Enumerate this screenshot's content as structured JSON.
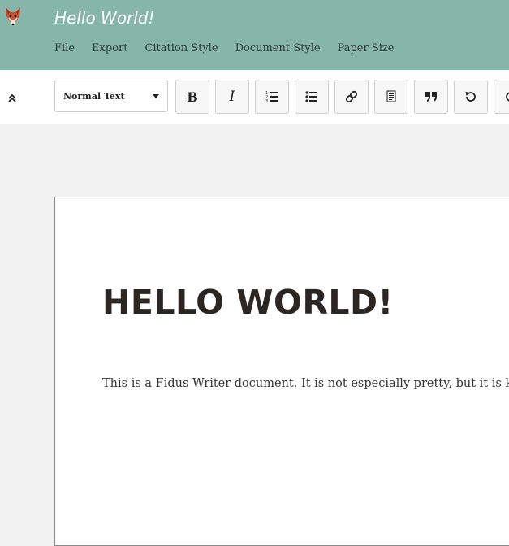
{
  "header": {
    "title": "Hello World!",
    "logo_icon": "fox-icon",
    "menu": [
      {
        "label": "File"
      },
      {
        "label": "Export"
      },
      {
        "label": "Citation Style"
      },
      {
        "label": "Document Style"
      },
      {
        "label": "Paper Size"
      }
    ]
  },
  "toolbar": {
    "collapse_icon": "double-chevron-up-icon",
    "block_type": {
      "selected": "Normal Text"
    },
    "buttons": [
      {
        "name": "bold",
        "glyph": "B"
      },
      {
        "name": "italic",
        "glyph": "I"
      },
      {
        "name": "numbered-list",
        "icon": "ordered-list-icon"
      },
      {
        "name": "bullet-list",
        "icon": "bullet-list-icon"
      },
      {
        "name": "link",
        "icon": "link-icon"
      },
      {
        "name": "footnote",
        "icon": "footnote-icon"
      },
      {
        "name": "blockquote",
        "icon": "quote-icon"
      },
      {
        "name": "undo",
        "icon": "undo-icon"
      },
      {
        "name": "redo",
        "icon": "redo-icon"
      }
    ]
  },
  "document": {
    "title": "HELLO WORLD!",
    "body": "This is a Fidus Writer document. It is not especially pretty, but it is kind of nice."
  },
  "colors": {
    "header_bg": "#86b5aa",
    "toolbar_bg": "#ffffff",
    "workspace_bg": "#f2f2f2",
    "paper_bg": "#ffffff"
  }
}
